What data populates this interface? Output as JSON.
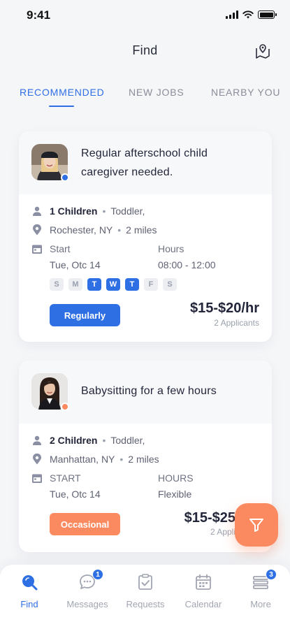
{
  "status": {
    "time": "9:41"
  },
  "header": {
    "title": "Find"
  },
  "tabs": [
    {
      "label": "RECOMMENDED",
      "active": true
    },
    {
      "label": "NEW JOBS",
      "active": false
    },
    {
      "label": "NEARBY YOU",
      "active": false
    }
  ],
  "jobs": [
    {
      "title": "Regular afterschool child caregiver needed.",
      "children_count": "1 Children",
      "age_group": "Toddler,",
      "location": "Rochester, NY",
      "distance": "2 miles",
      "start_label": "Start",
      "start_value": "Tue, Otc 14",
      "hours_label": "Hours",
      "hours_value": "08:00 - 12:00",
      "days": [
        {
          "label": "S",
          "on": false
        },
        {
          "label": "M",
          "on": false
        },
        {
          "label": "T",
          "on": true
        },
        {
          "label": "W",
          "on": true
        },
        {
          "label": "T",
          "on": true
        },
        {
          "label": "F",
          "on": false
        },
        {
          "label": "S",
          "on": false
        }
      ],
      "type_label": "Regularly",
      "type_color": "#2f6fe4",
      "price": "$15-$20/hr",
      "applicants": "2 Applicants",
      "presence_color": "#2f6fe4"
    },
    {
      "title": "Babysitting for a few hours",
      "children_count": "2 Children",
      "age_group": "Toddler,",
      "location": "Manhattan, NY",
      "distance": "2 miles",
      "start_label": "START",
      "start_value": "Tue, Otc 14",
      "hours_label": "HOURS",
      "hours_value": "Flexible",
      "type_label": "Occasional",
      "type_color": "#fb8a61",
      "price": "$15-$25",
      "applicants": "2 Appli",
      "presence_color": "#fb8a61"
    }
  ],
  "bottom_nav": [
    {
      "label": "Find",
      "icon": "search-icon",
      "active": true
    },
    {
      "label": "Messages",
      "icon": "chat-icon",
      "badge": "1"
    },
    {
      "label": "Requests",
      "icon": "clipboard-check-icon"
    },
    {
      "label": "Calendar",
      "icon": "calendar-icon"
    },
    {
      "label": "More",
      "icon": "stack-icon",
      "badge": "3"
    }
  ],
  "colors": {
    "accent": "#2f6fe4",
    "orange": "#fb8a61"
  }
}
